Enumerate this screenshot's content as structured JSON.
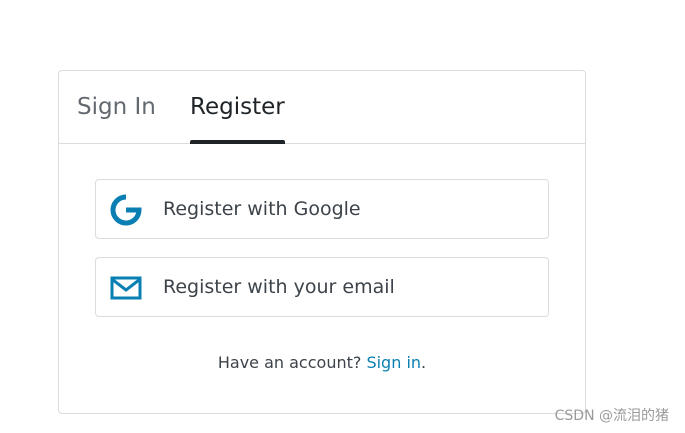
{
  "tabs": [
    {
      "label": "Sign In",
      "active": false
    },
    {
      "label": "Register",
      "active": true
    }
  ],
  "buttons": {
    "google": {
      "label": "Register with Google",
      "icon": "google-g-icon"
    },
    "email": {
      "label": "Register with your email",
      "icon": "envelope-icon"
    }
  },
  "footer": {
    "prompt": "Have an account? ",
    "link": "Sign in",
    "suffix": "."
  },
  "watermark": "CSDN @流泪的猪",
  "colors": {
    "accent": "#0a7fb3",
    "icon": "#0a7fb3",
    "active_tab": "#1d2327",
    "border": "#dcdcde"
  }
}
